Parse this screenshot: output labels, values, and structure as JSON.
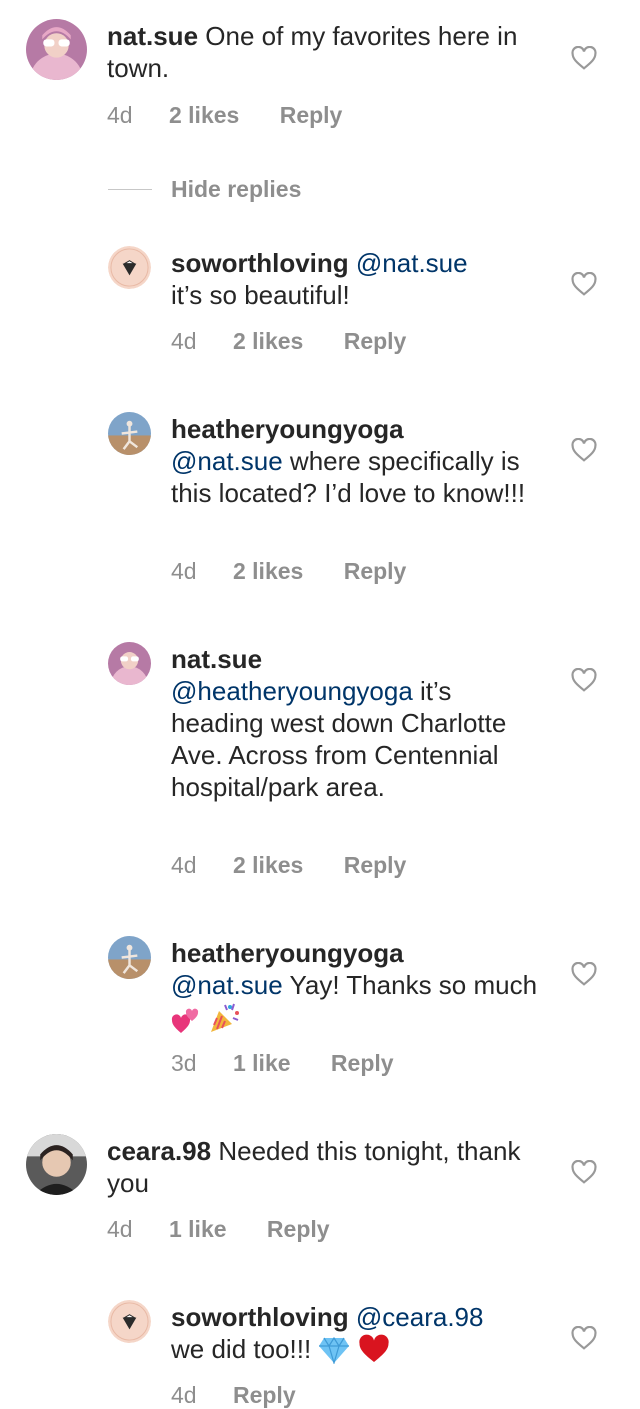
{
  "comments": [
    {
      "username": "nat.sue",
      "text": "One of my favorites here in town.",
      "time": "4d",
      "likes": "2 likes",
      "reply": "Reply",
      "avatar": "nat-sue-avatar"
    },
    {
      "username": "ceara.98",
      "text": "Needed this tonight, thank you",
      "time": "4d",
      "likes": "1 like",
      "reply": "Reply",
      "avatar": "ceara-avatar"
    }
  ],
  "hide_replies": "Hide replies",
  "replies": [
    {
      "username": "soworthloving",
      "mention": "@nat.sue",
      "text": "it’s so beautiful!",
      "time": "4d",
      "likes": "2 likes",
      "reply": "Reply"
    },
    {
      "username": "heatheryoungyoga",
      "mention": "@nat.sue",
      "text": "where specifically is this located? I’d love to know!!!",
      "time": "4d",
      "likes": "2 likes",
      "reply": "Reply"
    },
    {
      "username": "nat.sue",
      "mention": "@heatheryoungyoga",
      "text": "it’s heading west down Charlotte Ave. Across from Centennial hospital/park area.",
      "time": "4d",
      "likes": "2 likes",
      "reply": "Reply"
    },
    {
      "username": "heatheryoungyoga",
      "mention": "@nat.sue",
      "text": "Yay! Thanks so much",
      "time": "3d",
      "likes": "1 like",
      "reply": "Reply"
    },
    {
      "username": "soworthloving",
      "mention": "@ceara.98",
      "text": "we did too!!!",
      "time": "4d",
      "reply": "Reply"
    }
  ],
  "colors": {
    "text": "#262626",
    "meta": "#8e8e8e",
    "mention": "#003569",
    "heart_outline": "#999999"
  },
  "icons": [
    "heart-outline-icon",
    "two-hearts-emoji",
    "party-popper-emoji",
    "gem-emoji",
    "red-heart-emoji"
  ]
}
